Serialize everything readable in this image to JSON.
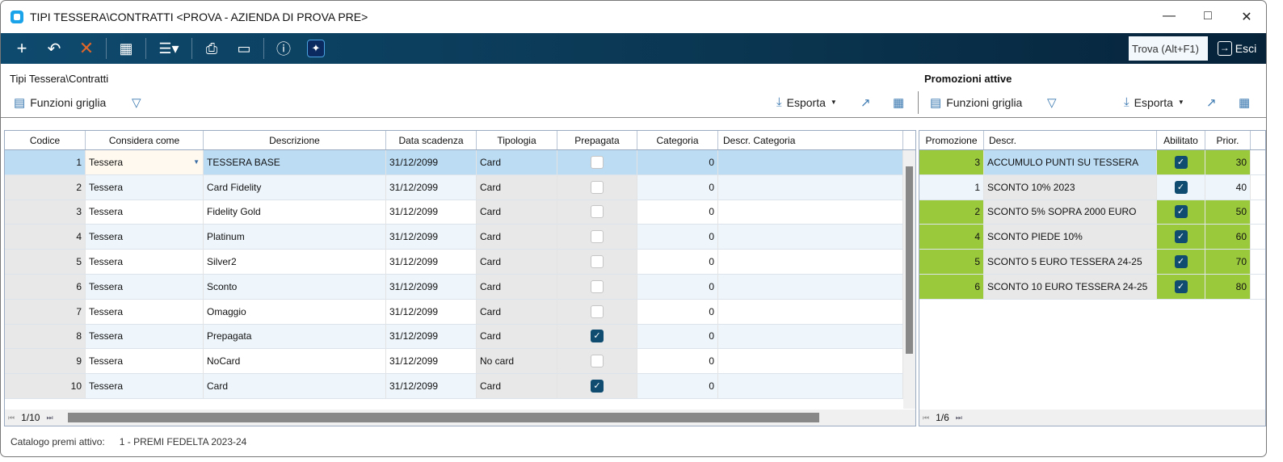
{
  "window": {
    "title": "TIPI TESSERA\\CONTRATTI <PROVA - AZIENDA DI PROVA PRE>"
  },
  "toolbar": {
    "search_placeholder": "Trova (Alt+F1)",
    "exit_label": "Esci"
  },
  "left": {
    "title": "Tipi Tessera\\Contratti",
    "functions_label": "Funzioni griglia",
    "export_label": "Esporta",
    "columns": [
      "Codice",
      "Considera come",
      "Descrizione",
      "Data scadenza",
      "Tipologia",
      "Prepagata",
      "Categoria",
      "Descr. Categoria"
    ],
    "rows": [
      {
        "codice": "1",
        "considera": "Tessera",
        "descr": "TESSERA BASE",
        "data": "31/12/2099",
        "tipo": "Card",
        "prepagata": false,
        "cat": "0",
        "desc_cat": ""
      },
      {
        "codice": "2",
        "considera": "Tessera",
        "descr": "Card Fidelity",
        "data": "31/12/2099",
        "tipo": "Card",
        "prepagata": false,
        "cat": "0",
        "desc_cat": ""
      },
      {
        "codice": "3",
        "considera": "Tessera",
        "descr": "Fidelity Gold",
        "data": "31/12/2099",
        "tipo": "Card",
        "prepagata": false,
        "cat": "0",
        "desc_cat": ""
      },
      {
        "codice": "4",
        "considera": "Tessera",
        "descr": "Platinum",
        "data": "31/12/2099",
        "tipo": "Card",
        "prepagata": false,
        "cat": "0",
        "desc_cat": ""
      },
      {
        "codice": "5",
        "considera": "Tessera",
        "descr": "Silver2",
        "data": "31/12/2099",
        "tipo": "Card",
        "prepagata": false,
        "cat": "0",
        "desc_cat": ""
      },
      {
        "codice": "6",
        "considera": "Tessera",
        "descr": "Sconto",
        "data": "31/12/2099",
        "tipo": "Card",
        "prepagata": false,
        "cat": "0",
        "desc_cat": ""
      },
      {
        "codice": "7",
        "considera": "Tessera",
        "descr": "Omaggio",
        "data": "31/12/2099",
        "tipo": "Card",
        "prepagata": false,
        "cat": "0",
        "desc_cat": ""
      },
      {
        "codice": "8",
        "considera": "Tessera",
        "descr": "Prepagata",
        "data": "31/12/2099",
        "tipo": "Card",
        "prepagata": true,
        "cat": "0",
        "desc_cat": ""
      },
      {
        "codice": "9",
        "considera": "Tessera",
        "descr": "NoCard",
        "data": "31/12/2099",
        "tipo": "No card",
        "prepagata": false,
        "cat": "0",
        "desc_cat": ""
      },
      {
        "codice": "10",
        "considera": "Tessera",
        "descr": "Card",
        "data": "31/12/2099",
        "tipo": "Card",
        "prepagata": true,
        "cat": "0",
        "desc_cat": ""
      }
    ],
    "pager": "1/10"
  },
  "right": {
    "title": "Promozioni attive",
    "functions_label": "Funzioni griglia",
    "export_label": "Esporta",
    "columns": [
      "Promozione",
      "Descr.",
      "Abilitato",
      "Prior."
    ],
    "rows": [
      {
        "promo": "3",
        "descr": "ACCUMULO PUNTI SU TESSERA",
        "enabled": true,
        "prior": "30",
        "green": true
      },
      {
        "promo": "1",
        "descr": "SCONTO 10% 2023",
        "enabled": true,
        "prior": "40",
        "green": false
      },
      {
        "promo": "2",
        "descr": "SCONTO 5% SOPRA 2000 EURO",
        "enabled": true,
        "prior": "50",
        "green": true
      },
      {
        "promo": "4",
        "descr": "SCONTO PIEDE 10%",
        "enabled": true,
        "prior": "60",
        "green": true
      },
      {
        "promo": "5",
        "descr": "SCONTO 5 EURO TESSERA 24-25",
        "enabled": true,
        "prior": "70",
        "green": true
      },
      {
        "promo": "6",
        "descr": "SCONTO 10 EURO TESSERA 24-25",
        "enabled": true,
        "prior": "80",
        "green": true
      }
    ],
    "pager": "1/6"
  },
  "footer": {
    "label": "Catalogo premi attivo:",
    "value": "1 - PREMI FEDELTA 2023-24"
  },
  "colors": {
    "green": "#9bc93c",
    "selected": "#bcdcf4",
    "toolbar": "#0a3550"
  }
}
